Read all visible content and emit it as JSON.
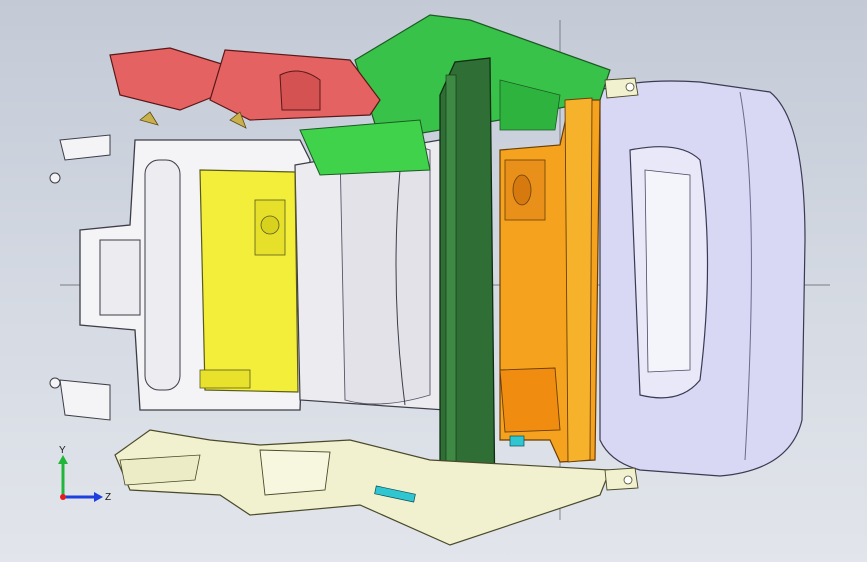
{
  "viewport": {
    "background_top": "#c3cad6",
    "background_bottom": "#e2e5eb"
  },
  "triad": {
    "y_label": "Y",
    "z_label": "Z",
    "x_color": "#e11d1d",
    "y_color": "#1fb63a",
    "z_color": "#1d3fe0"
  },
  "parts": {
    "white_frame": "#f4f4f6",
    "yellow_panel": "#f2ee3a",
    "red_duct": "#e56262",
    "green_cover": "#39c24a",
    "dark_green_bar": "#2f6e34",
    "orange_box": "#f5a21e",
    "lavender_housing": "#d8d8f4",
    "cream_bracket": "#f1f1cf",
    "cyan_tab": "#2fc6d2"
  }
}
